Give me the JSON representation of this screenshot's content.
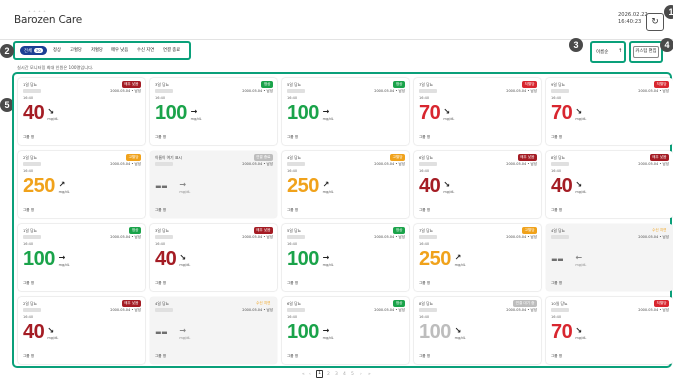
{
  "header": {
    "brand": "Barozen Care",
    "brand_sub": "+ + + +",
    "date": "2026.02.22",
    "time": "16:40:23",
    "refresh_icon": "refresh-icon",
    "refresh_glyph": "↻"
  },
  "markers": [
    "1",
    "2",
    "3",
    "4",
    "5"
  ],
  "filters": {
    "tabs": [
      {
        "label": "전체",
        "count": "30"
      },
      {
        "label": "정상"
      },
      {
        "label": "고혈당"
      },
      {
        "label": "저혈당"
      },
      {
        "label": "매우 낮음"
      },
      {
        "label": "수신 지연"
      },
      {
        "label": "연결 종료"
      }
    ]
  },
  "sort": {
    "label": "이름순",
    "icon": "sort-arrow-icon",
    "glyph": "↑"
  },
  "custom": {
    "label": "커스텀 편집"
  },
  "notice": "실시간 모니터링 최대 인원은 100명입니다.",
  "unit": "mg/dL",
  "colors": {
    "red": "#d8262f",
    "darkred": "#a41c24",
    "green": "#1aa34a",
    "orange": "#f0a21b",
    "gray": "#bdbdbd",
    "darkgray": "#6f6f6f"
  },
  "cards": [
    {
      "name": "1일 당뇨",
      "badge": "매우 낮음",
      "status": "darkred",
      "date": "2000.05.04 • 남성",
      "time": "16:40",
      "value": "40",
      "arrow": "↘",
      "group": "그룹 명"
    },
    {
      "name": "3일 당뇨",
      "badge": "정상",
      "status": "green",
      "date": "2000.05.04 • 남성",
      "time": "16:40",
      "value": "100",
      "arrow": "→",
      "group": "그룹 명"
    },
    {
      "name": "5일 당뇨",
      "badge": "정상",
      "status": "green",
      "date": "2000.05.04 • 남성",
      "time": "16:40",
      "value": "100",
      "arrow": "→",
      "group": "그룹 명"
    },
    {
      "name": "7일 당뇨",
      "badge": "저혈당",
      "status": "red",
      "date": "2000.05.04 • 남성",
      "time": "16:40",
      "value": "70",
      "arrow": "↘",
      "group": "그룹 명"
    },
    {
      "name": "9일 당뇨",
      "badge": "저혈당",
      "status": "red",
      "date": "2000.05.04 • 남성",
      "time": "16:40",
      "value": "70",
      "arrow": "↘",
      "group": "그룹 명"
    },
    {
      "name": "2일 당뇨",
      "badge": "고혈당",
      "status": "orange",
      "date": "2000.05.04 • 남성",
      "time": "16:40",
      "value": "250",
      "arrow": "↗",
      "group": "그룹 명"
    },
    {
      "name": "이름이 여기 표시",
      "badge": "연결 종료",
      "status": "gray",
      "date": "2000.05.04 • 남성",
      "time": "",
      "value": "--",
      "arrow": "→",
      "group": "그룹 명",
      "inactive": true
    },
    {
      "name": "4일 당뇨",
      "badge": "고혈당",
      "status": "orange",
      "date": "2000.05.04 • 남성",
      "time": "16:40",
      "value": "250",
      "arrow": "↗",
      "group": "그룹 명"
    },
    {
      "name": "6일 당뇨",
      "badge": "매우 낮음",
      "status": "darkred",
      "date": "2000.05.04 • 남성",
      "time": "16:40",
      "value": "40",
      "arrow": "↘",
      "group": "그룹 명"
    },
    {
      "name": "8일 당뇨",
      "badge": "매우 낮음",
      "status": "darkred",
      "date": "2000.05.04 • 남성",
      "time": "16:40",
      "value": "40",
      "arrow": "↘",
      "group": "그룹 명"
    },
    {
      "name": "1일 당뇨",
      "badge": "정상",
      "status": "green",
      "date": "2000.05.04 • 남성",
      "time": "16:40",
      "value": "100",
      "arrow": "→",
      "group": "그룹 명"
    },
    {
      "name": "3일 당뇨",
      "badge": "매우 낮음",
      "status": "darkred",
      "date": "2000.05.04 • 남성",
      "time": "16:40",
      "value": "40",
      "arrow": "↘",
      "group": "그룹 명"
    },
    {
      "name": "5일 당뇨",
      "badge": "정상",
      "status": "green",
      "date": "2000.05.04 • 남성",
      "time": "16:40",
      "value": "100",
      "arrow": "→",
      "group": "그룹 명"
    },
    {
      "name": "7일 당뇨",
      "badge": "고혈당",
      "status": "orange",
      "date": "2000.05.04 • 남성",
      "time": "16:40",
      "value": "250",
      "arrow": "↗",
      "group": "그룹 명"
    },
    {
      "name": "4일 당뇨",
      "badge": "수신 지연",
      "status": "orange",
      "outline": true,
      "date": "2000.05.04 • 남성",
      "time": "",
      "value": "--",
      "arrow": "←",
      "group": "그룹 명",
      "inactive": true
    },
    {
      "name": "2일 당뇨",
      "badge": "매우 낮음",
      "status": "darkred",
      "date": "2000.05.04 • 남성",
      "time": "16:40",
      "value": "40",
      "arrow": "↘",
      "group": "그룹 명"
    },
    {
      "name": "4일 당뇨",
      "badge": "수신 지연",
      "status": "orange",
      "outline": true,
      "date": "2000.05.04 • 남성",
      "time": "",
      "value": "--",
      "arrow": "→",
      "group": "그룹 명",
      "inactive": true
    },
    {
      "name": "6일 당뇨",
      "badge": "정상",
      "status": "green",
      "date": "2000.05.04 • 남성",
      "time": "16:40",
      "value": "100",
      "arrow": "→",
      "group": "그룹 명"
    },
    {
      "name": "8일 당뇨",
      "badge": "연결 대기 중",
      "status": "gray",
      "date": "2000.05.04 • 남성",
      "time": "16:40",
      "value": "100",
      "arrow": "↘",
      "group": "그룹 명"
    },
    {
      "name": "10일 당뇨",
      "badge": "저혈당",
      "status": "red",
      "date": "2000.05.04 • 남성",
      "time": "16:40",
      "value": "70",
      "arrow": "↘",
      "group": "그룹 명"
    }
  ],
  "pagination": {
    "first": "«",
    "prev": "‹",
    "pages": [
      "1",
      "2",
      "3",
      "4",
      "5"
    ],
    "active": "1",
    "next": "›",
    "last": "»"
  }
}
